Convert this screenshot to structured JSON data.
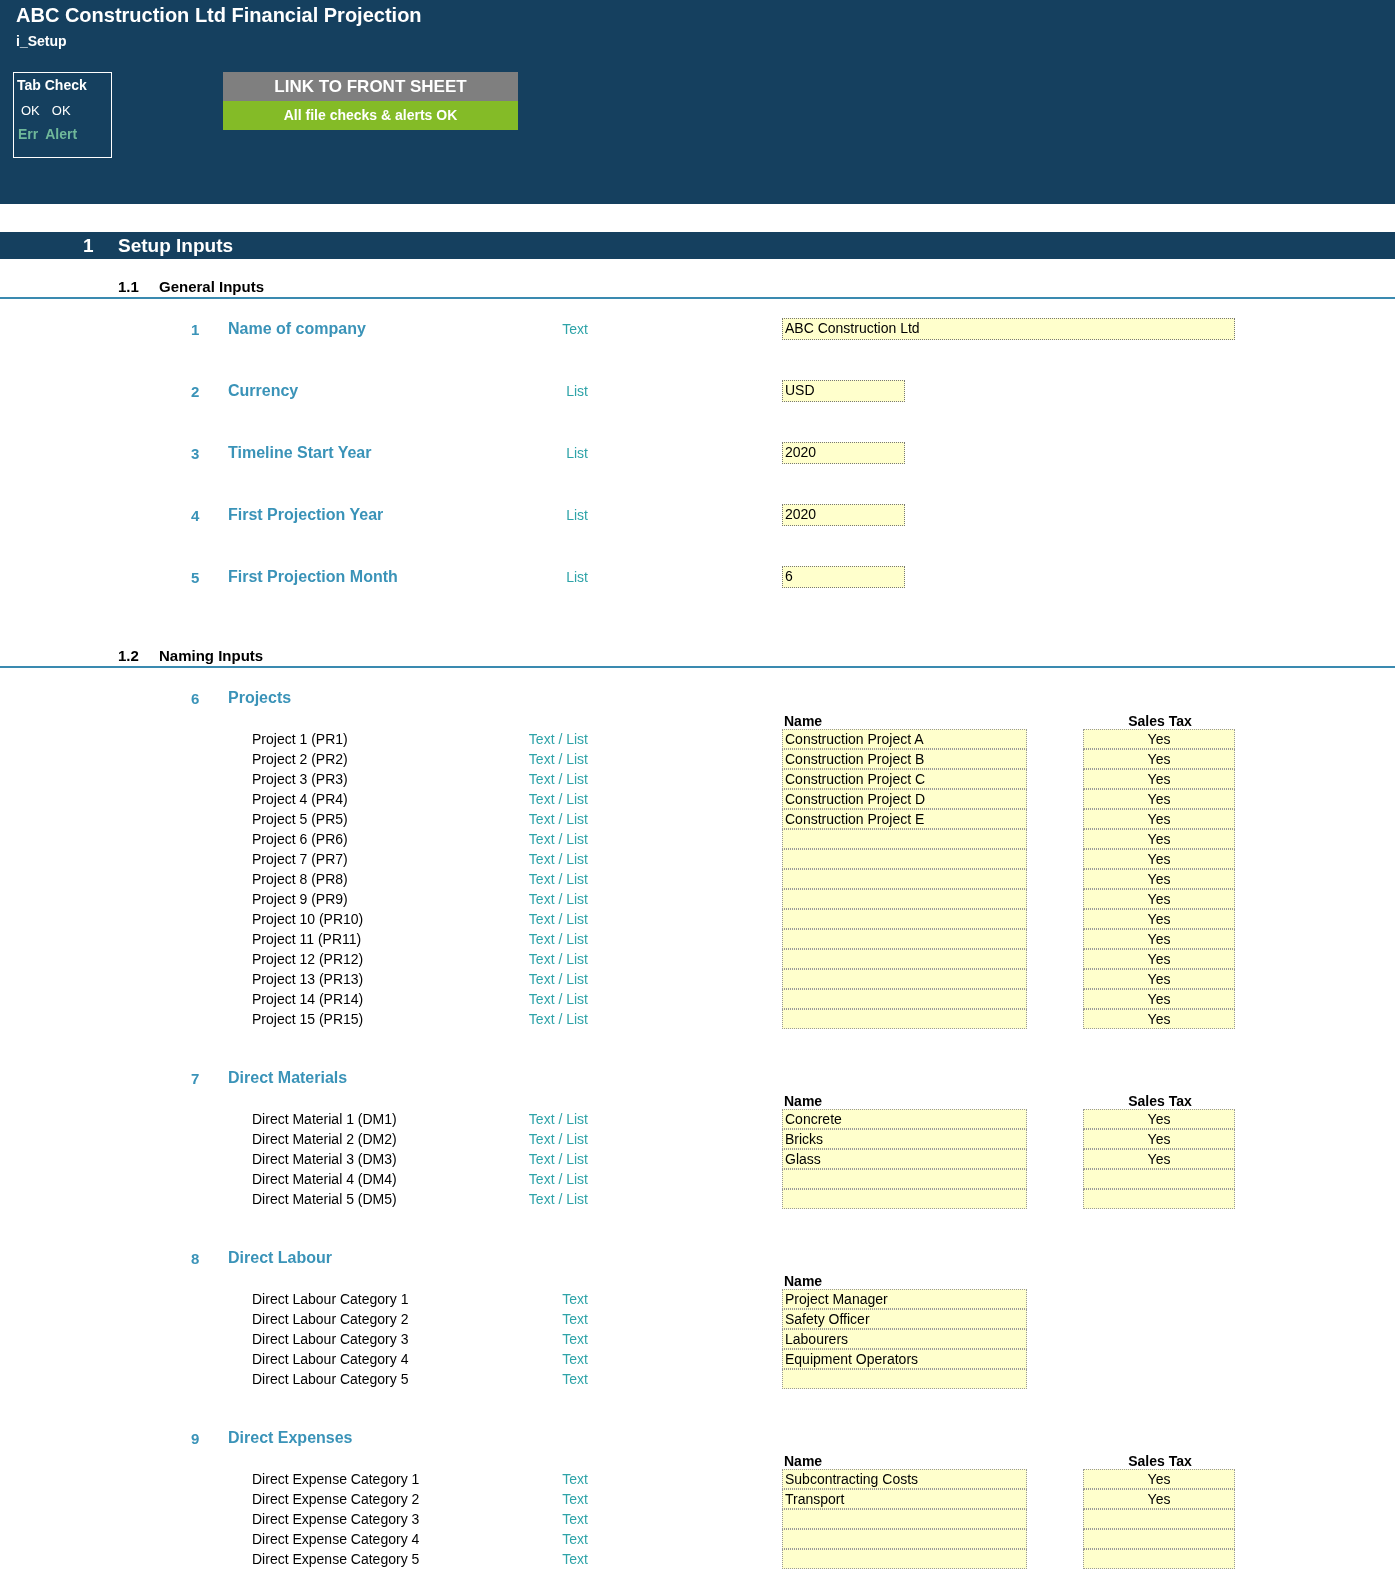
{
  "title": "ABC Construction Ltd Financial Projection",
  "sheet": "i_Setup",
  "tab_check": {
    "title": "Tab Check",
    "values": [
      "OK",
      "OK"
    ],
    "labels": [
      "Err",
      "Alert"
    ]
  },
  "link_button": "LINK TO FRONT SHEET",
  "status": "All file checks & alerts OK",
  "section": {
    "number": "1",
    "title": "Setup Inputs"
  },
  "general": {
    "number": "1.1",
    "title": "General Inputs",
    "items": [
      {
        "number": "1",
        "label": "Name of company",
        "type": "Text",
        "value": "ABC Construction Ltd",
        "kind": "long"
      },
      {
        "number": "2",
        "label": "Currency",
        "type": "List",
        "value": "USD",
        "kind": "short"
      },
      {
        "number": "3",
        "label": "Timeline Start Year",
        "type": "List",
        "value": "2020",
        "kind": "short"
      },
      {
        "number": "4",
        "label": "First Projection Year",
        "type": "List",
        "value": "2020",
        "kind": "short"
      },
      {
        "number": "5",
        "label": "First Projection Month",
        "type": "List",
        "value": "6",
        "kind": "short"
      }
    ]
  },
  "naming": {
    "number": "1.2",
    "title": "Naming Inputs",
    "groups": [
      {
        "number": "6",
        "title": "Projects",
        "columns": [
          "Name",
          "Sales Tax"
        ],
        "rows": [
          {
            "label": "Project 1 (PR1)",
            "type": "Text / List",
            "name": "Construction Project A",
            "sales_tax": "Yes"
          },
          {
            "label": "Project 2 (PR2)",
            "type": "Text / List",
            "name": "Construction Project B",
            "sales_tax": "Yes"
          },
          {
            "label": "Project 3 (PR3)",
            "type": "Text / List",
            "name": "Construction Project C",
            "sales_tax": "Yes"
          },
          {
            "label": "Project 4 (PR4)",
            "type": "Text / List",
            "name": "Construction Project D",
            "sales_tax": "Yes"
          },
          {
            "label": "Project 5 (PR5)",
            "type": "Text / List",
            "name": "Construction Project E",
            "sales_tax": "Yes"
          },
          {
            "label": "Project 6 (PR6)",
            "type": "Text / List",
            "sales_tax": "Yes"
          },
          {
            "label": "Project 7 (PR7)",
            "type": "Text / List",
            "sales_tax": "Yes"
          },
          {
            "label": "Project 8 (PR8)",
            "type": "Text / List",
            "sales_tax": "Yes"
          },
          {
            "label": "Project 9 (PR9)",
            "type": "Text / List",
            "sales_tax": "Yes"
          },
          {
            "label": "Project 10 (PR10)",
            "type": "Text / List",
            "sales_tax": "Yes"
          },
          {
            "label": "Project 11 (PR11)",
            "type": "Text / List",
            "sales_tax": "Yes"
          },
          {
            "label": "Project 12 (PR12)",
            "type": "Text / List",
            "sales_tax": "Yes"
          },
          {
            "label": "Project 13 (PR13)",
            "type": "Text / List",
            "sales_tax": "Yes"
          },
          {
            "label": "Project 14 (PR14)",
            "type": "Text / List",
            "sales_tax": "Yes"
          },
          {
            "label": "Project 15 (PR15)",
            "type": "Text / List",
            "sales_tax": "Yes"
          }
        ]
      },
      {
        "number": "7",
        "title": "Direct Materials",
        "columns": [
          "Name",
          "Sales Tax"
        ],
        "rows": [
          {
            "label": "Direct Material 1 (DM1)",
            "type": "Text / List",
            "name": "Concrete",
            "sales_tax": "Yes"
          },
          {
            "label": "Direct Material 2 (DM2)",
            "type": "Text / List",
            "name": "Bricks",
            "sales_tax": "Yes"
          },
          {
            "label": "Direct Material 3 (DM3)",
            "type": "Text / List",
            "name": "Glass",
            "sales_tax": "Yes"
          },
          {
            "label": "Direct Material 4 (DM4)",
            "type": "Text / List"
          },
          {
            "label": "Direct Material 5 (DM5)",
            "type": "Text / List"
          }
        ]
      },
      {
        "number": "8",
        "title": "Direct Labour",
        "columns": [
          "Name"
        ],
        "rows": [
          {
            "label": "Direct Labour Category 1",
            "type": "Text",
            "name": "Project Manager"
          },
          {
            "label": "Direct Labour Category 2",
            "type": "Text",
            "name": "Safety Officer"
          },
          {
            "label": "Direct Labour Category 3",
            "type": "Text",
            "name": "Labourers"
          },
          {
            "label": "Direct Labour Category 4",
            "type": "Text",
            "name": "Equipment Operators"
          },
          {
            "label": "Direct Labour Category 5",
            "type": "Text"
          }
        ]
      },
      {
        "number": "9",
        "title": "Direct Expenses",
        "columns": [
          "Name",
          "Sales Tax"
        ],
        "rows": [
          {
            "label": "Direct Expense Category 1",
            "type": "Text",
            "name": "Subcontracting Costs",
            "sales_tax": "Yes"
          },
          {
            "label": "Direct Expense Category 2",
            "type": "Text",
            "name": "Transport",
            "sales_tax": "Yes"
          },
          {
            "label": "Direct Expense Category 3",
            "type": "Text"
          },
          {
            "label": "Direct Expense Category 4",
            "type": "Text"
          },
          {
            "label": "Direct Expense Category 5",
            "type": "Text"
          }
        ]
      }
    ]
  }
}
